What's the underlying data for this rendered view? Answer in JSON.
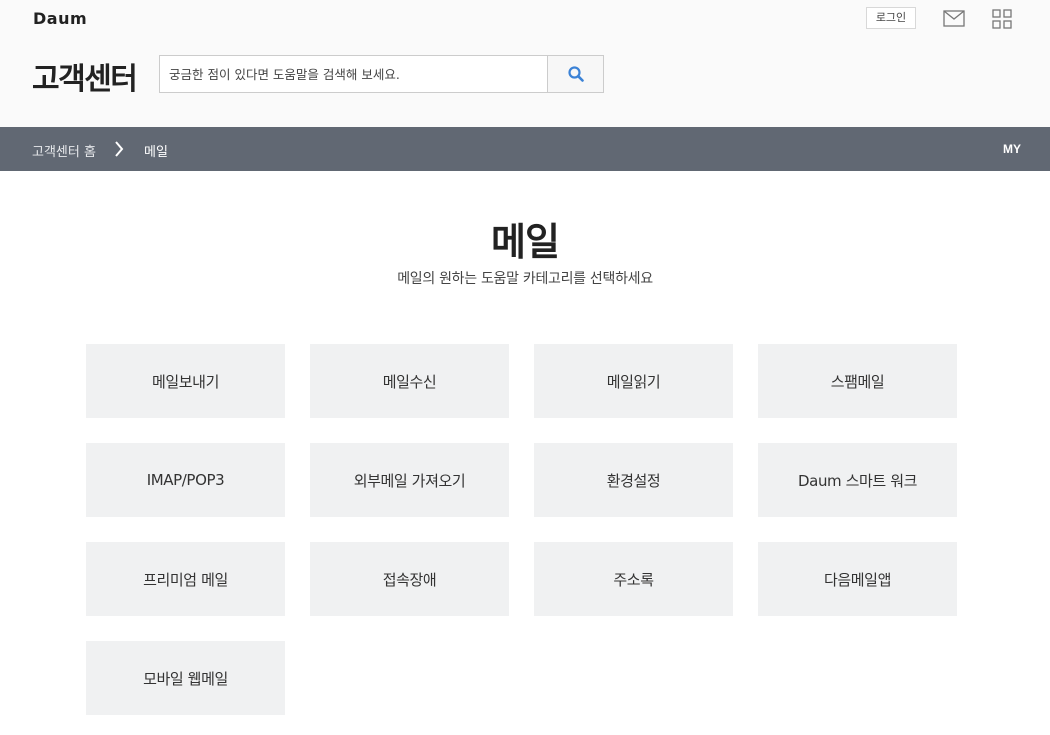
{
  "header": {
    "logo": "Daum",
    "login_label": "로그인",
    "mail_icon": "mail-icon",
    "apps_icon": "apps-grid-icon",
    "site_title": "고객센터",
    "search": {
      "placeholder": "궁금한 점이 있다면 도움말을 검색해 보세요.",
      "value": "",
      "button_icon": "search-icon",
      "accent_color": "#3b82d6"
    }
  },
  "nav": {
    "home_label": "고객센터 홈",
    "separator_icon": "chevron-right-icon",
    "current_label": "메일",
    "my_label": "MY",
    "background_color": "#616873"
  },
  "main": {
    "title": "메일",
    "subtitle": "메일의 원하는 도움말 카테고리를 선택하세요",
    "categories": [
      "메일보내기",
      "메일수신",
      "메일읽기",
      "스팸메일",
      "IMAP/POP3",
      "외부메일 가져오기",
      "환경설정",
      "Daum 스마트 워크",
      "프리미엄 메일",
      "접속장애",
      "주소록",
      "다음메일앱",
      "모바일 웹메일"
    ]
  }
}
